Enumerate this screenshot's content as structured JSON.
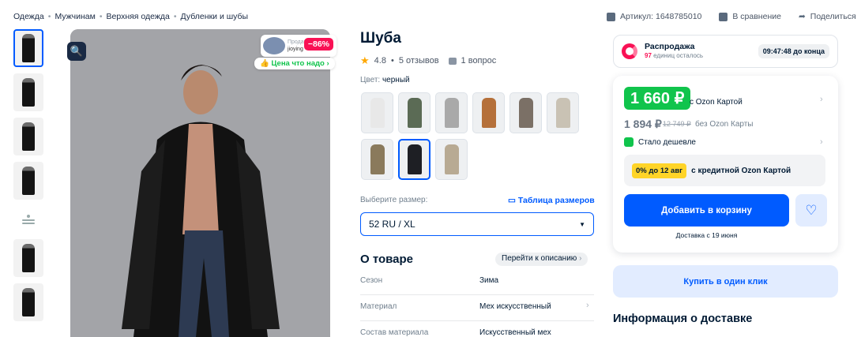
{
  "breadcrumb": [
    "Одежда",
    "Мужчинам",
    "Верхняя одежда",
    "Дубленки и шубы"
  ],
  "breadcrumb_sep": "•",
  "top_actions": {
    "article": "Артикул: 1648785010",
    "compare": "В сравнение",
    "share": "Поделиться"
  },
  "gallery": {
    "badge_label": "Продавец",
    "badge_seller": "jioying",
    "discount": "−86%",
    "price_tag": "Цена что надо"
  },
  "product": {
    "title": "Шуба",
    "rating": "4.8",
    "reviews": "5 отзывов",
    "questions": "1 вопрос",
    "color_label": "Цвет:",
    "color_value": "черный",
    "size_label": "Выберите размер:",
    "size_table": "Таблица размеров",
    "size_selected": "52 RU / XL",
    "swatch_colors": [
      "#e8e8e8",
      "#5b6b55",
      "#a9a9a9",
      "#b5703a",
      "#7b7066",
      "#c9c2b4",
      "#8a7a5c",
      "#1e1f24",
      "#b8aa93"
    ]
  },
  "about": {
    "title": "О товаре",
    "link": "Перейти к описанию",
    "rows": [
      {
        "name": "Сезон",
        "value": "Зима"
      },
      {
        "name": "Материал",
        "value": "Мех искусственный"
      },
      {
        "name": "Состав материала",
        "value": "Искусственный мех"
      }
    ]
  },
  "sale": {
    "title": "Распродажа",
    "count": "97",
    "count_suffix": "единиц осталось",
    "timer": "09:47:48 до конца"
  },
  "price": {
    "card_price": "1 660 ₽",
    "card_label": "c Ozon Картой",
    "price": "1 894 ₽",
    "old_price": "12 749 ₽",
    "no_card_label": "без Ozon Карты",
    "cheaper": "Стало дешевле",
    "credit_tag": "0% до 12 авг",
    "credit_text": "с кредитной Ozon Картой",
    "add_to_cart": "Добавить в корзину",
    "delivery": "Доставка с 19 июня"
  },
  "one_click": "Купить в один клик",
  "delivery_info_title": "Информация о доставке",
  "colors": {
    "accent": "#005bff",
    "green": "#10c44c",
    "pink": "#f91155",
    "yellow": "#ffd428"
  }
}
